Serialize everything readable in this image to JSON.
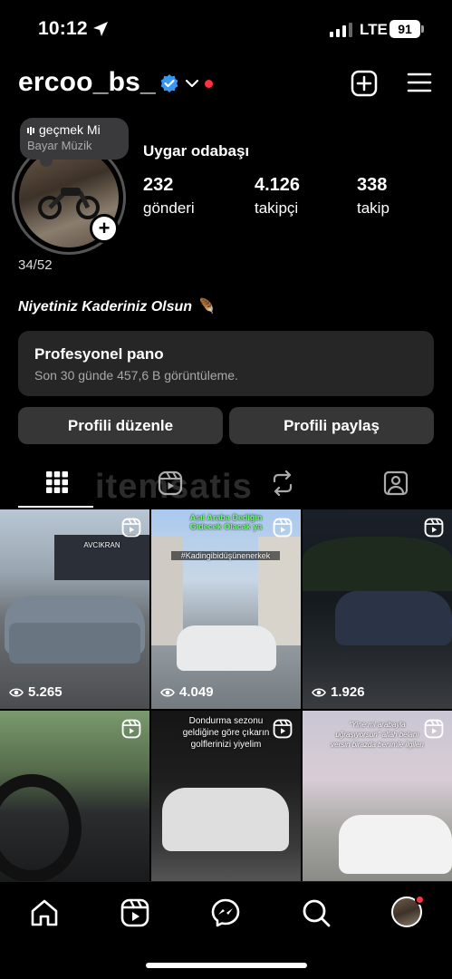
{
  "status": {
    "time": "10:12",
    "network": "LTE",
    "battery": "91"
  },
  "header": {
    "username": "ercoo_bs_"
  },
  "profile": {
    "note_line1": "geçmek Mi",
    "note_line2": "Bayar Müzik",
    "display_name": "Uygar odabaşı",
    "stats": [
      {
        "value": "232",
        "label": "gönderi"
      },
      {
        "value": "4.126",
        "label": "takipçi"
      },
      {
        "value": "338",
        "label": "takip"
      }
    ],
    "highlight_count": "34/52",
    "bio": "Niyetiniz Kaderiniz Olsun 🪶"
  },
  "pro_dashboard": {
    "title": "Profesyonel pano",
    "subtitle": "Son 30 günde 457,6 B görüntüleme."
  },
  "buttons": {
    "edit": "Profili düzenle",
    "share": "Profili paylaş"
  },
  "watermark": "itemsatis",
  "grid": [
    {
      "views": "5.265",
      "overlay": "AVCIKRAN"
    },
    {
      "views": "4.049",
      "overlay": "Asıl Araba Dediğin Gidecek Olacak ya",
      "overlay2": "#Kadingibidüşünenerkek"
    },
    {
      "views": "1.926",
      "overlay": ""
    },
    {
      "views": "",
      "overlay": ""
    },
    {
      "views": "",
      "overlay": "Dondurma sezonu geldiğine göre çıkarın golflerinizi yiyelim"
    },
    {
      "views": "",
      "overlay": "“Yine mi arabayla uğraşıyorsun” allah belanı versin birazda benimle ilgilen"
    }
  ],
  "icons": {
    "status": [
      "location-arrow-icon",
      "signal-icon"
    ],
    "header": [
      "verified-icon",
      "chevron-down-icon",
      "add-icon",
      "menu-icon"
    ],
    "tabs": [
      "grid-icon",
      "reels-icon",
      "reposts-icon",
      "tagged-icon"
    ],
    "nav": [
      "home-icon",
      "reels-icon",
      "messenger-icon",
      "search-icon",
      "profile-avatar"
    ]
  },
  "colors": {
    "background": "#000000",
    "card": "#262626",
    "button": "#363636",
    "accent_blue": "#3897f0",
    "notification_red": "#ff3040"
  }
}
